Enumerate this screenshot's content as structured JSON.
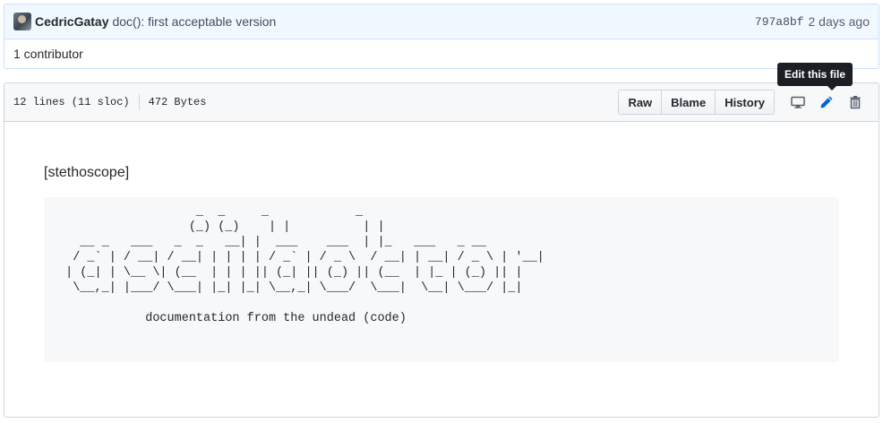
{
  "commit": {
    "author": "CedricGatay",
    "message": "doc(): first acceptable version",
    "sha": "797a8bf",
    "time": "2 days ago"
  },
  "contributors": "1 contributor",
  "file": {
    "lines": "12 lines (11 sloc)",
    "size": "472 Bytes",
    "buttons": {
      "raw": "Raw",
      "blame": "Blame",
      "history": "History"
    },
    "tooltip": "Edit this file",
    "icons": [
      "desktop-icon",
      "pencil-icon",
      "trash-icon"
    ]
  },
  "readme": {
    "tag": "[stethoscope]",
    "ascii": "                   _  _     _            _\n                  (_) (_)    | |          | |\n   __ _   ___   _  _   __| |  ___    ___  | |_   ___   _ __\n  / _` | / __| / __| | | | | / _` | / _ \\  / __| | __| / _ \\ | '__|\n | (_| | \\__ \\| (__  | | | || (_| || (_) || (__  | |_ | (_) || |\n  \\__,_| |___/ \\___| |_| |_| \\__,_| \\___/  \\___|  \\__| \\___/ |_|\n\n            documentation from the undead (code)"
  },
  "colors": {
    "accent": "#0366d6",
    "commit_bg": "#f1f8ff",
    "header_bg": "#f6f8fa"
  }
}
